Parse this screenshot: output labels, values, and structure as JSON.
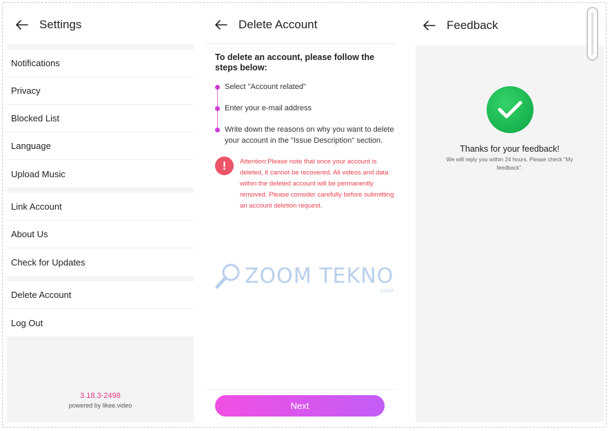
{
  "settings": {
    "title": "Settings",
    "groups": [
      [
        "Notifications",
        "Privacy",
        "Blocked List",
        "Language",
        "Upload Music"
      ],
      [
        "Link Account",
        "About Us",
        "Check for Updates"
      ],
      [
        "Delete Account",
        "Log Out"
      ]
    ],
    "version": "3.18.3-2498",
    "powered_by": "powered by likee.video"
  },
  "delete_account": {
    "title": "Delete Account",
    "intro": "To delete an account, please follow the steps below:",
    "steps": [
      "Select \"Account related\"",
      "Enter your e-mail address",
      "Write down the reasons on why you want to delete your account in the \"Issue Description\" section."
    ],
    "attention": "Attention:Please note that once your account is deleted, it cannot be recovered. All videos and data within the deleted account will be permanently removed. Please consider carefully before submitting an account deletion request.",
    "watermark": "ZOOM TEKNO",
    "watermark_suffix": ".COM",
    "next_label": "Next"
  },
  "feedback": {
    "title": "Feedback",
    "thanks": "Thanks for your feedback!",
    "reply": "We will reply you within 24 hours. Please check \"My feedback\"."
  },
  "colors": {
    "accent_pink": "#e5337a",
    "button_gradient_start": "#f14fe3",
    "button_gradient_end": "#c25df6",
    "warning_red": "#e8404c",
    "success_green": "#17b34e"
  }
}
